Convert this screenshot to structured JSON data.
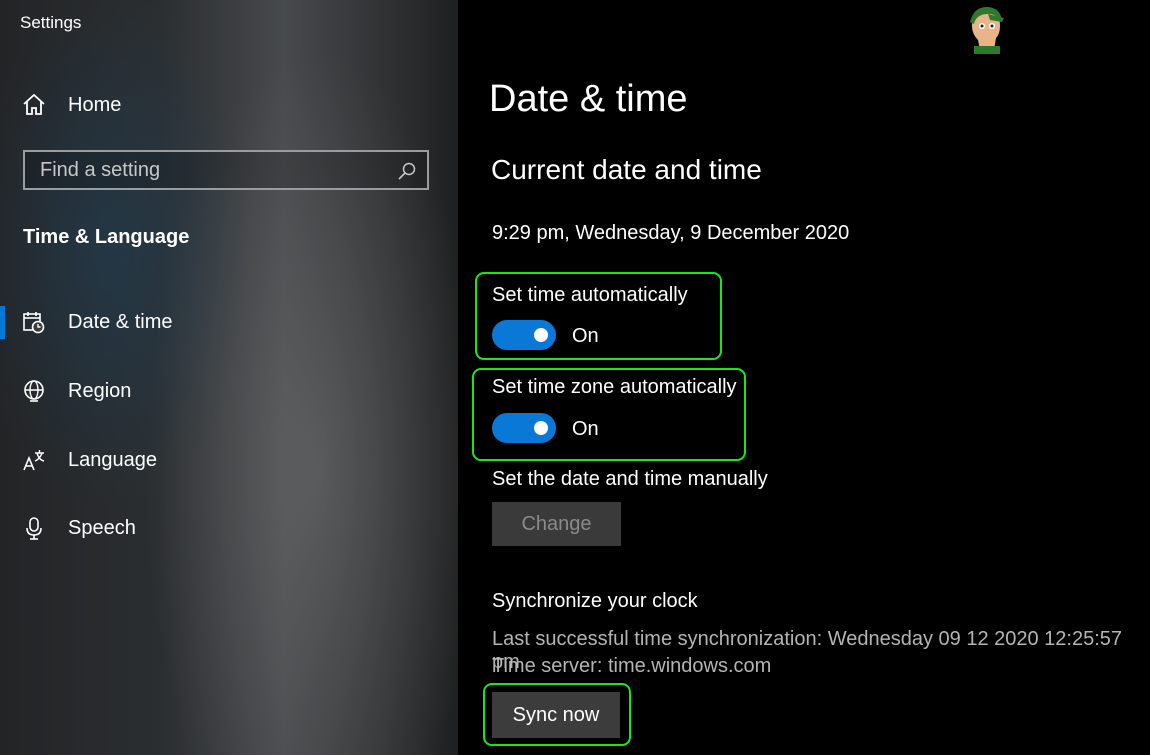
{
  "window": {
    "title": "Settings"
  },
  "sidebar": {
    "home_label": "Home",
    "search_placeholder": "Find a setting",
    "section_title": "Time & Language",
    "items": [
      {
        "label": "Date & time",
        "icon": "calendar-clock-icon",
        "active": true
      },
      {
        "label": "Region",
        "icon": "globe-icon",
        "active": false
      },
      {
        "label": "Language",
        "icon": "language-icon",
        "active": false
      },
      {
        "label": "Speech",
        "icon": "microphone-icon",
        "active": false
      }
    ]
  },
  "main": {
    "title": "Date & time",
    "subtitle": "Current date and time",
    "current_datetime": "9:29 pm, Wednesday, 9 December 2020",
    "set_time_auto": {
      "label": "Set time automatically",
      "state": "On"
    },
    "set_timezone_auto": {
      "label": "Set time zone automatically",
      "state": "On"
    },
    "manual": {
      "label": "Set the date and time manually",
      "button": "Change"
    },
    "sync": {
      "heading": "Synchronize your clock",
      "last_sync": "Last successful time synchronization: Wednesday 09 12 2020 12:25:57 pm",
      "server": "Time server: time.windows.com",
      "button": "Sync now"
    }
  },
  "colors": {
    "accent": "#0078d7",
    "toggle_on": "#0a78d7",
    "highlight": "#19e619"
  }
}
